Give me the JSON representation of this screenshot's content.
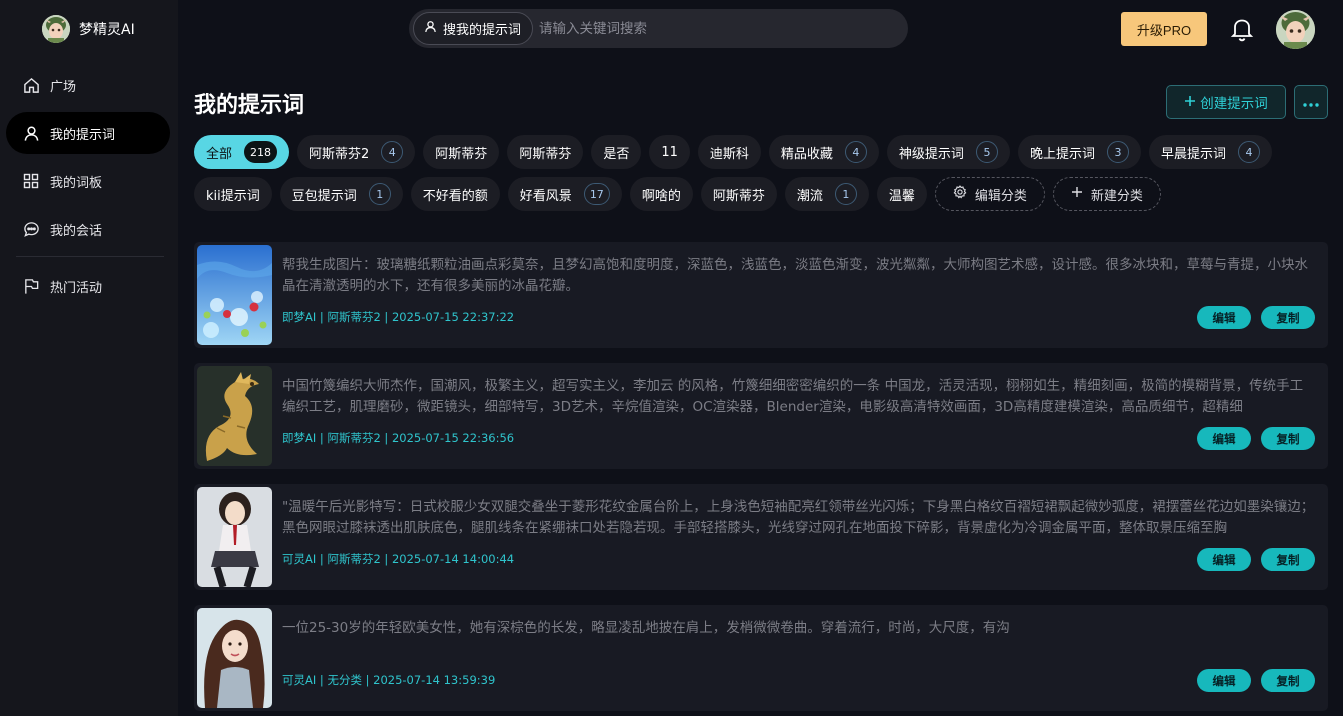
{
  "brand": {
    "name": "梦精灵AI",
    "avatar_icon": "elf-avatar-icon"
  },
  "sidebar": {
    "items": [
      {
        "label": "广场",
        "icon": "home-icon"
      },
      {
        "label": "我的提示词",
        "icon": "user-icon",
        "active": true
      },
      {
        "label": "我的词板",
        "icon": "grid-icon"
      },
      {
        "label": "我的会话",
        "icon": "chat-icon"
      },
      {
        "label": "热门活动",
        "icon": "flag-icon"
      }
    ]
  },
  "header": {
    "search_scope": "搜我的提示词",
    "search_placeholder": "请输入关键词搜索",
    "upgrade_label": "升级PRO"
  },
  "page": {
    "title": "我的提示词",
    "create_label": "创建提示词"
  },
  "categories": [
    {
      "label": "全部",
      "count": "218",
      "active": true
    },
    {
      "label": "阿斯蒂芬2",
      "count": "4"
    },
    {
      "label": "阿斯蒂芬",
      "count": ""
    },
    {
      "label": "阿斯蒂芬",
      "count": ""
    },
    {
      "label": "是否",
      "count": ""
    },
    {
      "label": "11",
      "count": ""
    },
    {
      "label": "迪斯科",
      "count": ""
    },
    {
      "label": "精品收藏",
      "count": "4"
    },
    {
      "label": "神级提示词",
      "count": "5"
    },
    {
      "label": "晚上提示词",
      "count": "3"
    },
    {
      "label": "早晨提示词",
      "count": "4"
    },
    {
      "label": "kii提示词",
      "count": ""
    },
    {
      "label": "豆包提示词",
      "count": "1"
    },
    {
      "label": "不好看的额",
      "count": ""
    },
    {
      "label": "好看风景",
      "count": "17"
    },
    {
      "label": "啊啥的",
      "count": ""
    },
    {
      "label": "阿斯蒂芬",
      "count": ""
    },
    {
      "label": "潮流",
      "count": "1"
    },
    {
      "label": "温馨",
      "count": ""
    }
  ],
  "category_actions": {
    "edit_label": "编辑分类",
    "new_label": "新建分类"
  },
  "prompts": [
    {
      "text": "帮我生成图片：玻璃糖纸颗粒油画点彩莫奈，且梦幻高饱和度明度，深蓝色，浅蓝色，淡蓝色渐变，波光粼粼，大师构图艺术感，设计感。很多冰块和，草莓与青提，小块水晶在清澈透明的水下，还有很多美丽的冰晶花瓣。",
      "meta": "即梦AI | 阿斯蒂芬2 | 2025-07-15 22:37:22",
      "thumb": "ice-strawberry"
    },
    {
      "text": "中国竹篾编织大师杰作，国潮风，极繁主义，超写实主义，李加云 的风格，竹篾细细密密编织的一条 中国龙，活灵活现，栩栩如生，精细刻画，极简的模糊背景，传统手工编织工艺，肌理磨砂，微距镜头，细部特写，3D艺术，辛烷值渲染，OC渲染器，Blender渲染，电影级高清特效画面，3D高精度建模渲染，高品质细节，超精细",
      "meta": "即梦AI | 阿斯蒂芬2 | 2025-07-15 22:36:56",
      "thumb": "golden-dragon"
    },
    {
      "text": "\"温暖午后光影特写：日式校服少女双腿交叠坐于菱形花纹金属台阶上，上身浅色短袖配亮红领带丝光闪烁；下身黑白格纹百褶短裙飘起微妙弧度，裙摆蕾丝花边如墨染镶边；黑色网眼过膝袜透出肌肤底色，腿肌线条在紧绷袜口处若隐若现。手部轻搭膝头，光线穿过网孔在地面投下碎影，背景虚化为冷调金属平面，整体取景压缩至胸",
      "meta": "可灵AI | 阿斯蒂芬2 | 2025-07-14 14:00:44",
      "thumb": "school-girl"
    },
    {
      "text": "一位25-30岁的年轻欧美女性，她有深棕色的长发，略显凌乱地披在肩上，发梢微微卷曲。穿着流行，时尚，大尺度，有沟",
      "meta": "可灵AI | 无分类 | 2025-07-14 13:59:39",
      "thumb": "woman-portrait"
    }
  ],
  "card_actions": {
    "edit_label": "编辑",
    "copy_label": "复制"
  },
  "colors": {
    "accent": "#2fc4cc",
    "upgrade": "#f7c77b",
    "active_chip": "#58d6e4"
  }
}
